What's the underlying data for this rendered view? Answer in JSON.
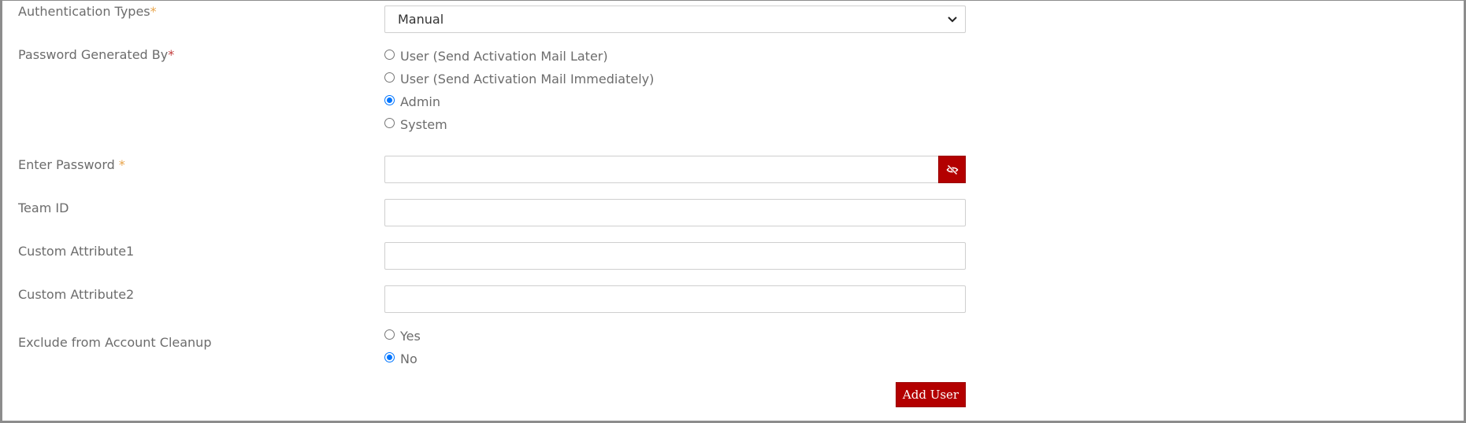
{
  "auth_types": {
    "label": "Authentication Types",
    "required_mark": "*",
    "selected_value": "Manual"
  },
  "password_generated_by": {
    "label": "Password Generated By",
    "required_mark": "*",
    "options": [
      {
        "label": "User (Send Activation Mail Later)",
        "checked": false
      },
      {
        "label": "User (Send Activation Mail Immediately)",
        "checked": false
      },
      {
        "label": "Admin",
        "checked": true
      },
      {
        "label": "System",
        "checked": false
      }
    ]
  },
  "enter_password": {
    "label": "Enter Password",
    "required_mark": "*",
    "value": "",
    "toggle_icon": "eye-slash-icon"
  },
  "team_id": {
    "label": "Team ID",
    "value": ""
  },
  "custom_attribute1": {
    "label": "Custom Attribute1",
    "value": ""
  },
  "custom_attribute2": {
    "label": "Custom Attribute2",
    "value": ""
  },
  "exclude_cleanup": {
    "label": "Exclude from Account Cleanup",
    "options": [
      {
        "label": "Yes",
        "checked": false
      },
      {
        "label": "No",
        "checked": true
      }
    ]
  },
  "actions": {
    "add_user_label": "Add User"
  },
  "colors": {
    "accent_red": "#b30000",
    "radio_blue": "#0075ff",
    "required_red": "#c23b3b",
    "required_orange": "#e8a44a",
    "label_gray": "#6c6c6c"
  }
}
